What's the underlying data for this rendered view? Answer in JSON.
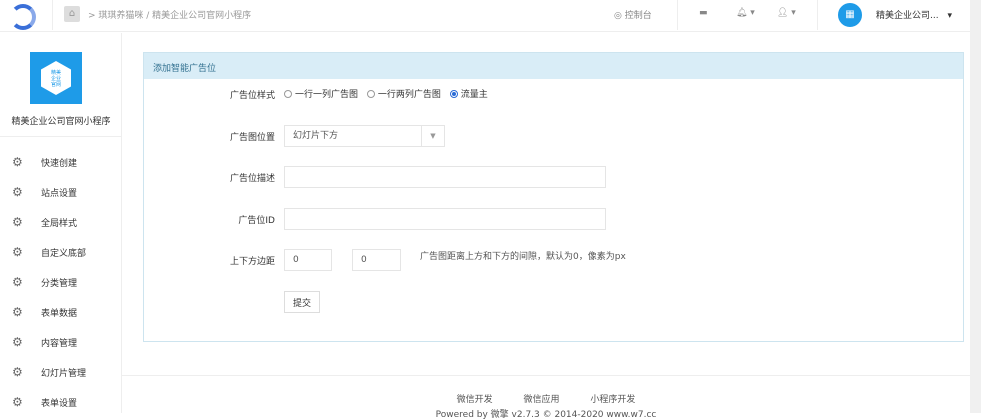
{
  "topbar": {
    "breadcrumb": "> 琪琪养猫咪 / 精美企业公司官网小程序",
    "console": "控制台",
    "account": "精美企业公司...",
    "avatar_text": "▦"
  },
  "sidebar": {
    "app_name": "精美企业公司官网小程序",
    "logo_text": "精美企业官网",
    "items": [
      {
        "label": "快速创建"
      },
      {
        "label": "站点设置"
      },
      {
        "label": "全局样式"
      },
      {
        "label": "自定义底部"
      },
      {
        "label": "分类管理"
      },
      {
        "label": "表单数据"
      },
      {
        "label": "内容管理"
      },
      {
        "label": "幻灯片管理"
      },
      {
        "label": "表单设置"
      }
    ]
  },
  "panel": {
    "title": "添加智能广告位",
    "style_label": "广告位样式",
    "style_options": [
      "一行一列广告图",
      "一行两列广告图",
      "流量主"
    ],
    "style_selected": "流量主",
    "position_label": "广告图位置",
    "position_value": "幻灯片下方",
    "desc_label": "广告位描述",
    "desc_value": "",
    "id_label": "广告位ID",
    "id_value": "",
    "margin_label": "上下方边距",
    "margin_top": "0",
    "margin_bottom": "0",
    "margin_help": "广告图距离上方和下方的间隙，默认为0，像素为px",
    "submit": "提交"
  },
  "footer": {
    "links": [
      "微信开发",
      "微信应用",
      "小程序开发"
    ],
    "powered": "Powered by 微擎 v2.7.3 © 2014-2020 www.w7.cc"
  },
  "colors": {
    "accent": "#1e9be8",
    "panel_header": "#d9edf7"
  }
}
